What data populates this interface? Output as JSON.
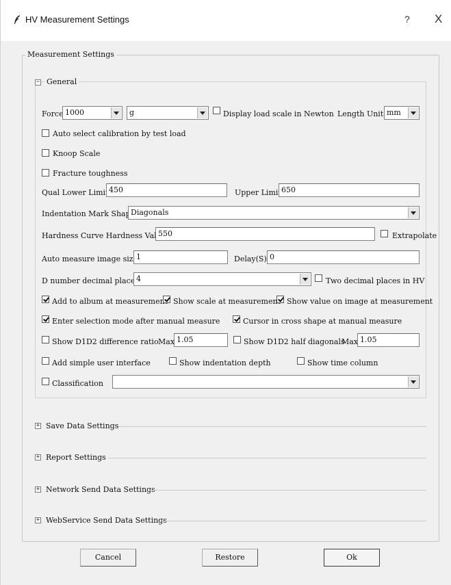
{
  "window": {
    "title": "HV Measurement Settings",
    "help": "?",
    "close": "X"
  },
  "outer_group": {
    "caption": "Measurement Settings"
  },
  "general": {
    "caption": "General",
    "expander": "−",
    "force_label": "Force",
    "force_value": "1000",
    "unit_value": "g",
    "newton_label": "Display load scale in Newton",
    "length_unit_label": "Length Unit",
    "length_unit_value": "mm",
    "auto_calib_label": "Auto select calibration by test load",
    "knoop_label": "Knoop Scale",
    "fracture_label": "Fracture toughness",
    "qual_lower_label": "Qual Lower Limit",
    "qual_lower_value": "450",
    "upper_limit_label": "Upper Limit",
    "upper_limit_value": "650",
    "mark_shape_label": "Indentation Mark Shape",
    "mark_shape_value": "Diagonals",
    "curve_label": "Hardness Curve Hardness Value",
    "curve_value": "550",
    "extrapolate_label": "Extrapolate",
    "auto_size_label": "Auto measure image size",
    "auto_size_value": "1",
    "delay_label": "Delay(S)",
    "delay_value": "0",
    "decimal_label": "D number decimal places",
    "decimal_value": "4",
    "two_decimal_label": "Two decimal places in HV",
    "album_label": "Add to album at measurement",
    "show_scale_label": "Show scale at measurement",
    "show_value_label": "Show value on image at measurement",
    "selection_mode_label": "Enter selection mode after manual measure",
    "cursor_label": "Cursor in cross shape at manual measure",
    "d1d2_ratio_label": "Show D1D2 difference ratio",
    "max1_label": "Max",
    "max1_value": "1.05",
    "d1d2_half_label": "Show D1D2 half diagonals",
    "max2_label": "Max",
    "max2_value": "1.05",
    "simple_ui_label": "Add simple user interface",
    "depth_label": "Show indentation depth",
    "time_col_label": "Show time column",
    "classification_label": "Classification",
    "classification_value": ""
  },
  "checkboxes": {
    "newton": false,
    "auto_calib": false,
    "knoop": false,
    "fracture": false,
    "extrapolate": false,
    "two_decimal": false,
    "album": true,
    "show_scale": true,
    "show_value": true,
    "selection_mode": true,
    "cursor": true,
    "d1d2_ratio": false,
    "d1d2_half": false,
    "simple_ui": false,
    "depth": false,
    "time_col": false,
    "classification": false
  },
  "sections": [
    {
      "label": "Save Data Settings",
      "expander": "+"
    },
    {
      "label": "Report Settings",
      "expander": "+"
    },
    {
      "label": "Network Send Data Settings",
      "expander": "+"
    },
    {
      "label": "WebService Send Data Settings",
      "expander": "+"
    }
  ],
  "buttons": {
    "cancel": "Cancel",
    "restore": "Restore",
    "ok": "Ok"
  }
}
